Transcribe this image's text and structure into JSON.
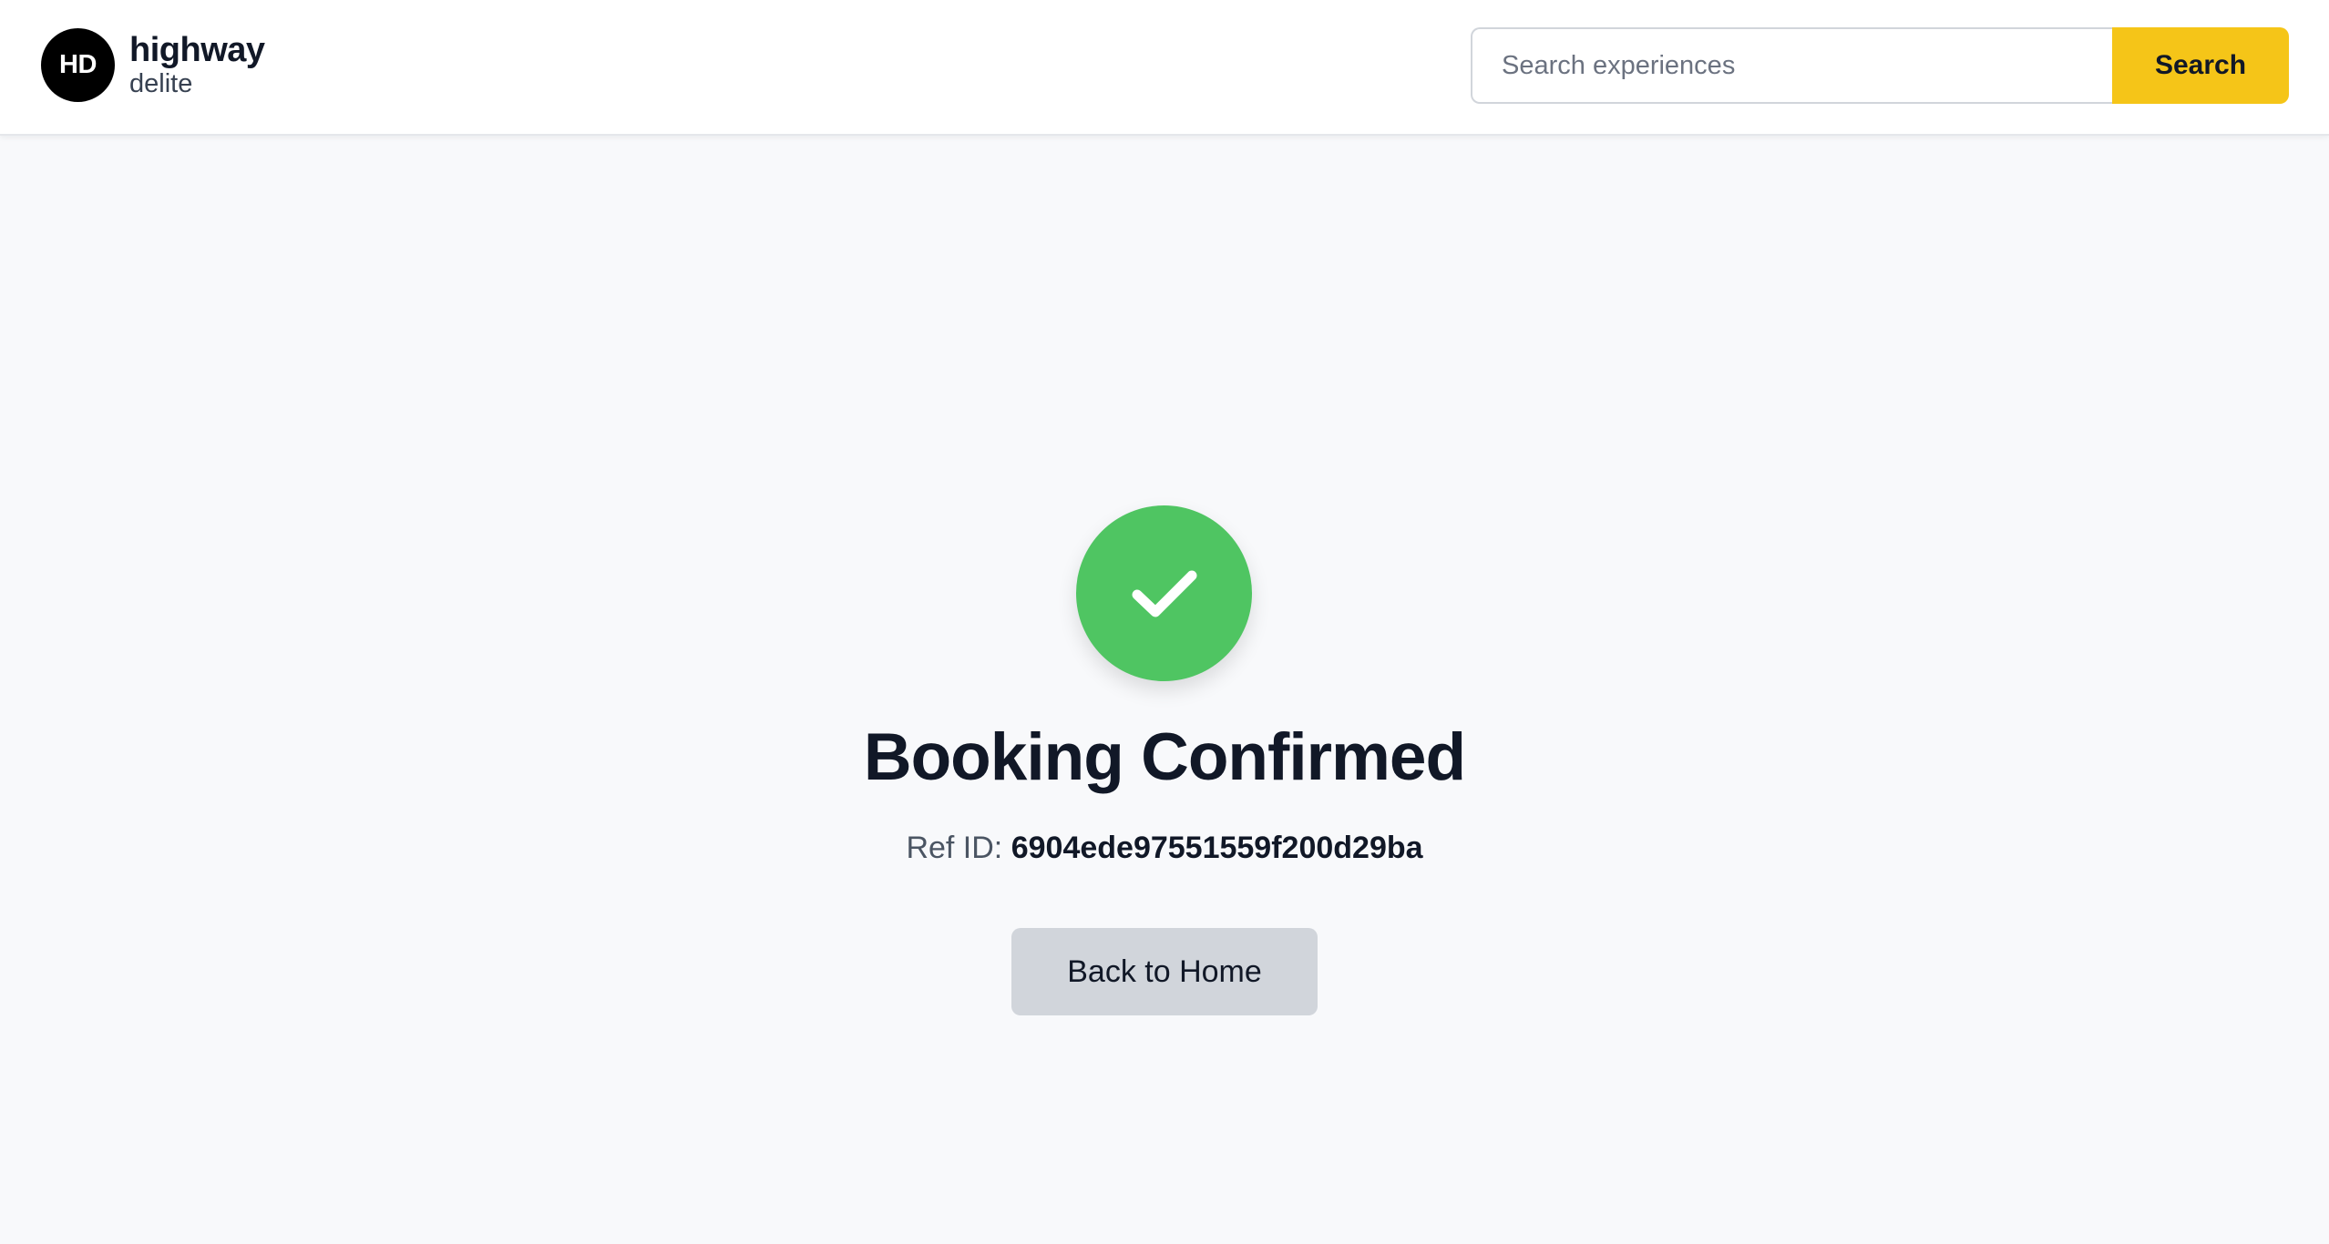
{
  "header": {
    "logo_badge": "HD",
    "logo_title": "highway",
    "logo_subtitle": "delite",
    "search": {
      "placeholder": "Search experiences",
      "value": "",
      "button_label": "Search"
    }
  },
  "confirmation": {
    "icon": "checkmark-icon",
    "title": "Booking Confirmed",
    "ref_label": "Ref ID:",
    "ref_value": "6904ede97551559f200d29ba",
    "home_button_label": "Back to Home"
  },
  "colors": {
    "accent_yellow": "#f5c518",
    "success_green": "#4fc562",
    "home_button_gray": "#d1d5db"
  }
}
